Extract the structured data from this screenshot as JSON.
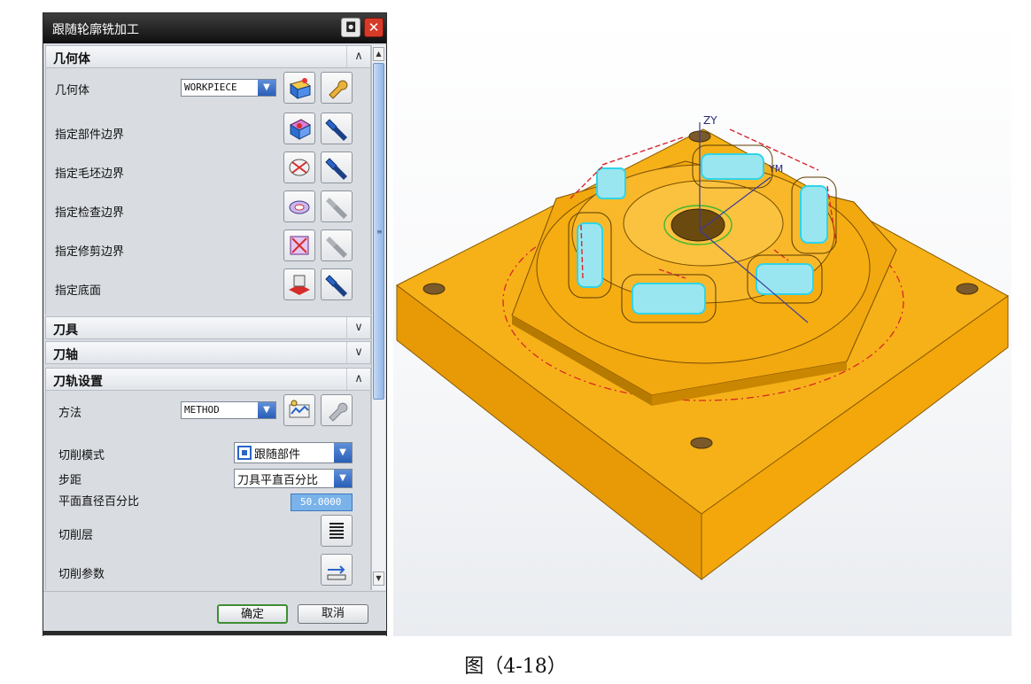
{
  "dialog": {
    "title": "跟随轮廓铣加工",
    "info_glyph": "◘",
    "close_glyph": "✕",
    "ok_label": "确定",
    "cancel_label": "取消"
  },
  "sections": {
    "geometry": {
      "title": "几何体",
      "chevron": "∧",
      "rows": {
        "geometry": {
          "label": "几何体",
          "value": "WORKPIECE"
        },
        "part_boundary": {
          "label": "指定部件边界"
        },
        "blank_boundary": {
          "label": "指定毛坯边界"
        },
        "check_boundary": {
          "label": "指定检查边界"
        },
        "trim_boundary": {
          "label": "指定修剪边界"
        },
        "floor": {
          "label": "指定底面"
        }
      }
    },
    "tool": {
      "title": "刀具",
      "chevron": "∨"
    },
    "axis": {
      "title": "刀轴",
      "chevron": "∨"
    },
    "path": {
      "title": "刀轨设置",
      "chevron": "∧",
      "rows": {
        "method": {
          "label": "方法",
          "value": "METHOD"
        },
        "cut_pattern": {
          "label": "切削模式",
          "value": "跟随部件"
        },
        "stepover": {
          "label": "步距",
          "value": "刀具平直百分比"
        },
        "percent": {
          "label": "平面直径百分比",
          "value": "50.0000"
        },
        "cut_levels": {
          "label": "切削层"
        },
        "cut_params": {
          "label": "切削参数"
        }
      }
    }
  },
  "scroll": {
    "up_glyph": "▲",
    "down_glyph": "▼",
    "grip": "≡"
  },
  "viewport": {
    "axis_z": "ZY",
    "axis_ym": "YM"
  },
  "caption": "图（4-18）",
  "colors": {
    "part": "#f4a70c",
    "part_dark": "#c98100",
    "toolpath": "#30d4e8",
    "boundary": "#d8262a"
  }
}
